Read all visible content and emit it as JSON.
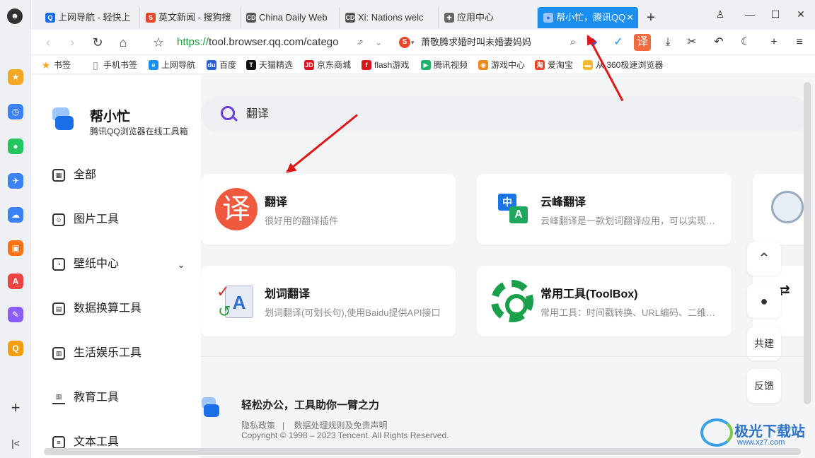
{
  "browser": {
    "tabs": [
      {
        "label": "上网导航 - 轻快上",
        "icon": "qq-nav-icon",
        "color": "#1a6fe8",
        "glyph": "Q"
      },
      {
        "label": "英文新闻 - 搜狗搜",
        "icon": "sogou-icon",
        "color": "#e8452c",
        "glyph": "S"
      },
      {
        "label": "China Daily Web",
        "icon": "chinadaily-icon",
        "color": "#555555",
        "glyph": "CD"
      },
      {
        "label": "Xi: Nations welc",
        "icon": "chinadaily-icon",
        "color": "#555555",
        "glyph": "CD"
      },
      {
        "label": "应用中心",
        "icon": "puzzle-icon",
        "color": "#666666",
        "glyph": "✚"
      },
      {
        "label": "帮小忙，腾讯QQ",
        "icon": "bangxiaomang-icon",
        "color": "#ffffff",
        "glyph": "●"
      }
    ],
    "new_tab": "+",
    "url_proto": "https://",
    "url_rest": "tool.browser.qq.com/catego",
    "search_query": "萧敬腾求婚时叫未婚妻妈妈",
    "translate_btn": "译"
  },
  "bookmarks": [
    {
      "label": "书签",
      "color": "#f5a623",
      "glyph": "★"
    },
    {
      "label": "手机书签",
      "color": "#888888",
      "glyph": "▯"
    },
    {
      "label": "上网导航",
      "color": "#1a8ff0",
      "glyph": "e"
    },
    {
      "label": "百度",
      "color": "#2b5fd6",
      "glyph": "du"
    },
    {
      "label": "天猫精选",
      "color": "#111111",
      "glyph": "T"
    },
    {
      "label": "京东商城",
      "color": "#d8161b",
      "glyph": "JD"
    },
    {
      "label": "flash游戏",
      "color": "#d8161b",
      "glyph": "f"
    },
    {
      "label": "腾讯视频",
      "color": "#20b26b",
      "glyph": "▶"
    },
    {
      "label": "游戏中心",
      "color": "#f08a1c",
      "glyph": "◉"
    },
    {
      "label": "爱淘宝",
      "color": "#e8452c",
      "glyph": "淘"
    },
    {
      "label": "从 360极速浏览器",
      "color": "#f5b82e",
      "glyph": "▬"
    }
  ],
  "sidebar": {
    "brand_title": "帮小忙",
    "brand_subtitle": "腾讯QQ浏览器在线工具箱",
    "items": [
      {
        "label": "全部",
        "icon": "grid-icon"
      },
      {
        "label": "图片工具",
        "icon": "image-icon"
      },
      {
        "label": "壁纸中心",
        "icon": "wallpaper-icon"
      },
      {
        "label": "数据换算工具",
        "icon": "chart-icon"
      },
      {
        "label": "生活娱乐工具",
        "icon": "gamepad-icon"
      },
      {
        "label": "教育工具",
        "icon": "school-icon"
      },
      {
        "label": "文本工具",
        "icon": "document-icon"
      }
    ]
  },
  "search": {
    "query": "翻译"
  },
  "results": [
    {
      "title": "翻译",
      "desc": "很好用的翻译插件",
      "icon": "translate-icon"
    },
    {
      "title": "云峰翻译",
      "desc": "云峰翻译是一款划词翻译应用，可以实现网页翻译",
      "icon": "yunfeng-translate-icon"
    },
    {
      "title": "划词翻译",
      "desc": "划词翻译(可划长句),使用Baidu提供API接口",
      "icon": "select-translate-icon"
    },
    {
      "title": "常用工具(ToolBox)",
      "desc": "常用工具：时间戳转换、URL编码、二维码生成",
      "icon": "gear-icon"
    }
  ],
  "float_buttons": {
    "top": "⌃",
    "qq": "●",
    "build": "共建",
    "feedback": "反馈"
  },
  "footer": {
    "slogan": "轻松办公，工具助你一臂之力",
    "link1": "隐私政策",
    "sep": "|",
    "link2": "数据处理规则及免责声明",
    "copyright": "Copyright © 1998 – 2023 Tencent. All Rights Reserved."
  },
  "watermark": {
    "name": "极光下载站",
    "url": "www.xz7.com"
  },
  "colors": {
    "accent": "#1a8ff0",
    "arrow": "#e01515",
    "brand_blue": "#1a6fe8"
  }
}
